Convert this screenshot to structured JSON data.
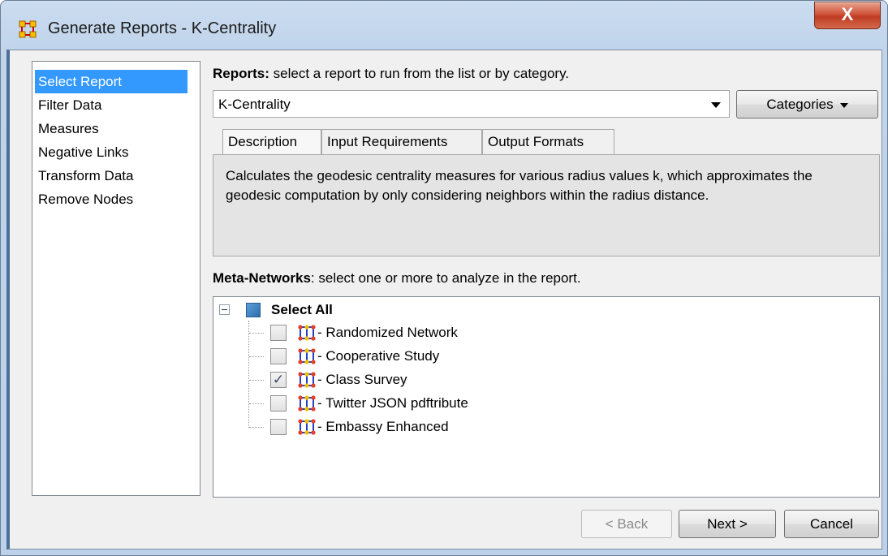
{
  "window": {
    "title": "Generate Reports - K-Centrality",
    "close_label": "X"
  },
  "sidebar": {
    "items": [
      {
        "label": "Select Report",
        "selected": true
      },
      {
        "label": "Filter Data"
      },
      {
        "label": "Measures"
      },
      {
        "label": "Negative Links"
      },
      {
        "label": "Transform Data"
      },
      {
        "label": "Remove Nodes"
      }
    ]
  },
  "reports": {
    "label_bold": "Reports:",
    "label_rest": " select a report to run from the list or by category.",
    "selected": "K-Centrality",
    "categories_label": "Categories"
  },
  "tabs": [
    {
      "label": "Description",
      "active": true
    },
    {
      "label": "Input Requirements"
    },
    {
      "label": "Output Formats"
    }
  ],
  "description": "Calculates the geodesic centrality measures for various radius values k, which approximates the geodesic computation by only considering neighbors within the radius distance.",
  "meta_networks": {
    "label_bold": "Meta-Networks",
    "label_rest": ": select one or more to analyze in the report.",
    "select_all": "Select All",
    "items": [
      {
        "label": "- Randomized Network",
        "checked": false
      },
      {
        "label": "- Cooperative Study",
        "checked": false
      },
      {
        "label": "- Class Survey",
        "checked": true
      },
      {
        "label": "- Twitter JSON pdftribute",
        "checked": false
      },
      {
        "label": "- Embassy Enhanced",
        "checked": false
      }
    ]
  },
  "buttons": {
    "back": "< Back",
    "next": "Next >",
    "cancel": "Cancel"
  },
  "colors": {
    "selection": "#3399ff",
    "title_close": "#c7432a"
  }
}
